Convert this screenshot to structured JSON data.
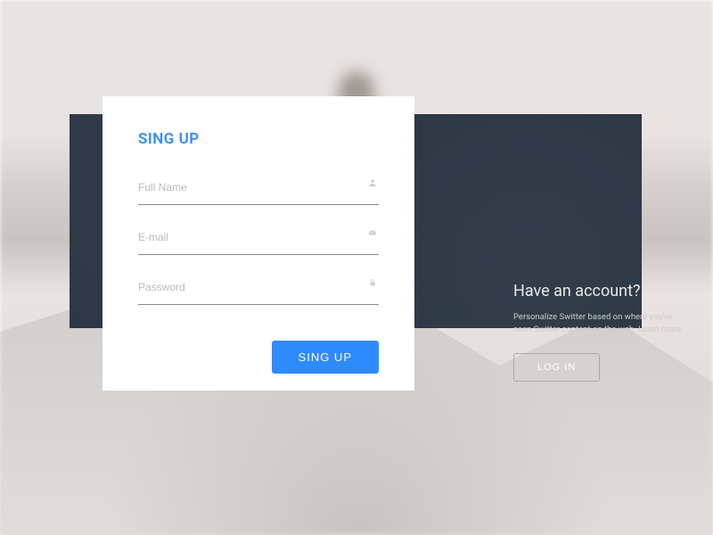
{
  "signup": {
    "title": "SING UP",
    "fields": {
      "fullname": {
        "placeholder": "Full Name",
        "icon": "user-icon"
      },
      "email": {
        "placeholder": "E-mail",
        "icon": "mail-icon"
      },
      "password": {
        "placeholder": "Password",
        "icon": "lock-icon"
      }
    },
    "submit_label": "SING UP"
  },
  "login_side": {
    "title": "Have an account?",
    "subtitle": "Personalize Switter based on where you've seen Switter content on the web. Learn more.",
    "button_label": "LOG IN"
  },
  "colors": {
    "accent": "#2e8bff",
    "dark_panel": "#2b3644"
  }
}
